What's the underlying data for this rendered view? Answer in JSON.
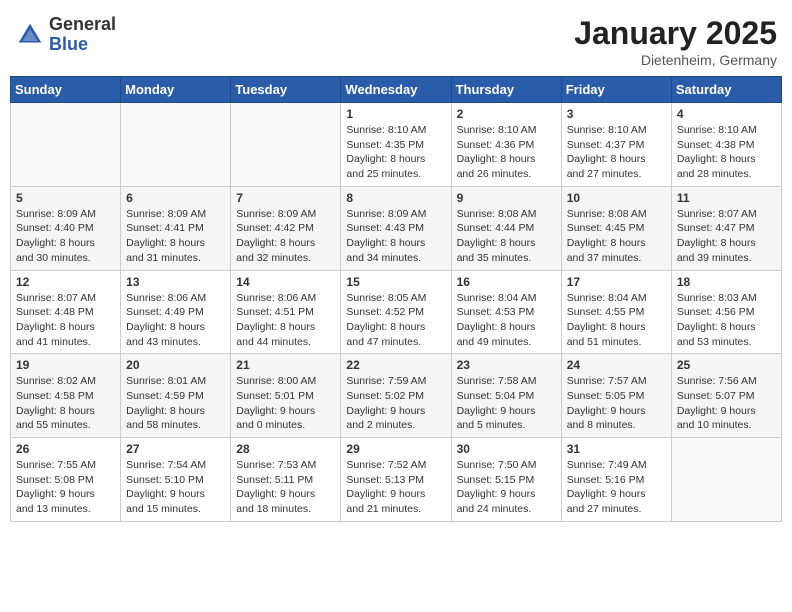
{
  "header": {
    "logo_general": "General",
    "logo_blue": "Blue",
    "month_title": "January 2025",
    "subtitle": "Dietenheim, Germany"
  },
  "days_of_week": [
    "Sunday",
    "Monday",
    "Tuesday",
    "Wednesday",
    "Thursday",
    "Friday",
    "Saturday"
  ],
  "weeks": [
    [
      {
        "day": "",
        "info": ""
      },
      {
        "day": "",
        "info": ""
      },
      {
        "day": "",
        "info": ""
      },
      {
        "day": "1",
        "info": "Sunrise: 8:10 AM\nSunset: 4:35 PM\nDaylight: 8 hours and 25 minutes."
      },
      {
        "day": "2",
        "info": "Sunrise: 8:10 AM\nSunset: 4:36 PM\nDaylight: 8 hours and 26 minutes."
      },
      {
        "day": "3",
        "info": "Sunrise: 8:10 AM\nSunset: 4:37 PM\nDaylight: 8 hours and 27 minutes."
      },
      {
        "day": "4",
        "info": "Sunrise: 8:10 AM\nSunset: 4:38 PM\nDaylight: 8 hours and 28 minutes."
      }
    ],
    [
      {
        "day": "5",
        "info": "Sunrise: 8:09 AM\nSunset: 4:40 PM\nDaylight: 8 hours and 30 minutes."
      },
      {
        "day": "6",
        "info": "Sunrise: 8:09 AM\nSunset: 4:41 PM\nDaylight: 8 hours and 31 minutes."
      },
      {
        "day": "7",
        "info": "Sunrise: 8:09 AM\nSunset: 4:42 PM\nDaylight: 8 hours and 32 minutes."
      },
      {
        "day": "8",
        "info": "Sunrise: 8:09 AM\nSunset: 4:43 PM\nDaylight: 8 hours and 34 minutes."
      },
      {
        "day": "9",
        "info": "Sunrise: 8:08 AM\nSunset: 4:44 PM\nDaylight: 8 hours and 35 minutes."
      },
      {
        "day": "10",
        "info": "Sunrise: 8:08 AM\nSunset: 4:45 PM\nDaylight: 8 hours and 37 minutes."
      },
      {
        "day": "11",
        "info": "Sunrise: 8:07 AM\nSunset: 4:47 PM\nDaylight: 8 hours and 39 minutes."
      }
    ],
    [
      {
        "day": "12",
        "info": "Sunrise: 8:07 AM\nSunset: 4:48 PM\nDaylight: 8 hours and 41 minutes."
      },
      {
        "day": "13",
        "info": "Sunrise: 8:06 AM\nSunset: 4:49 PM\nDaylight: 8 hours and 43 minutes."
      },
      {
        "day": "14",
        "info": "Sunrise: 8:06 AM\nSunset: 4:51 PM\nDaylight: 8 hours and 44 minutes."
      },
      {
        "day": "15",
        "info": "Sunrise: 8:05 AM\nSunset: 4:52 PM\nDaylight: 8 hours and 47 minutes."
      },
      {
        "day": "16",
        "info": "Sunrise: 8:04 AM\nSunset: 4:53 PM\nDaylight: 8 hours and 49 minutes."
      },
      {
        "day": "17",
        "info": "Sunrise: 8:04 AM\nSunset: 4:55 PM\nDaylight: 8 hours and 51 minutes."
      },
      {
        "day": "18",
        "info": "Sunrise: 8:03 AM\nSunset: 4:56 PM\nDaylight: 8 hours and 53 minutes."
      }
    ],
    [
      {
        "day": "19",
        "info": "Sunrise: 8:02 AM\nSunset: 4:58 PM\nDaylight: 8 hours and 55 minutes."
      },
      {
        "day": "20",
        "info": "Sunrise: 8:01 AM\nSunset: 4:59 PM\nDaylight: 8 hours and 58 minutes."
      },
      {
        "day": "21",
        "info": "Sunrise: 8:00 AM\nSunset: 5:01 PM\nDaylight: 9 hours and 0 minutes."
      },
      {
        "day": "22",
        "info": "Sunrise: 7:59 AM\nSunset: 5:02 PM\nDaylight: 9 hours and 2 minutes."
      },
      {
        "day": "23",
        "info": "Sunrise: 7:58 AM\nSunset: 5:04 PM\nDaylight: 9 hours and 5 minutes."
      },
      {
        "day": "24",
        "info": "Sunrise: 7:57 AM\nSunset: 5:05 PM\nDaylight: 9 hours and 8 minutes."
      },
      {
        "day": "25",
        "info": "Sunrise: 7:56 AM\nSunset: 5:07 PM\nDaylight: 9 hours and 10 minutes."
      }
    ],
    [
      {
        "day": "26",
        "info": "Sunrise: 7:55 AM\nSunset: 5:08 PM\nDaylight: 9 hours and 13 minutes."
      },
      {
        "day": "27",
        "info": "Sunrise: 7:54 AM\nSunset: 5:10 PM\nDaylight: 9 hours and 15 minutes."
      },
      {
        "day": "28",
        "info": "Sunrise: 7:53 AM\nSunset: 5:11 PM\nDaylight: 9 hours and 18 minutes."
      },
      {
        "day": "29",
        "info": "Sunrise: 7:52 AM\nSunset: 5:13 PM\nDaylight: 9 hours and 21 minutes."
      },
      {
        "day": "30",
        "info": "Sunrise: 7:50 AM\nSunset: 5:15 PM\nDaylight: 9 hours and 24 minutes."
      },
      {
        "day": "31",
        "info": "Sunrise: 7:49 AM\nSunset: 5:16 PM\nDaylight: 9 hours and 27 minutes."
      },
      {
        "day": "",
        "info": ""
      }
    ]
  ]
}
